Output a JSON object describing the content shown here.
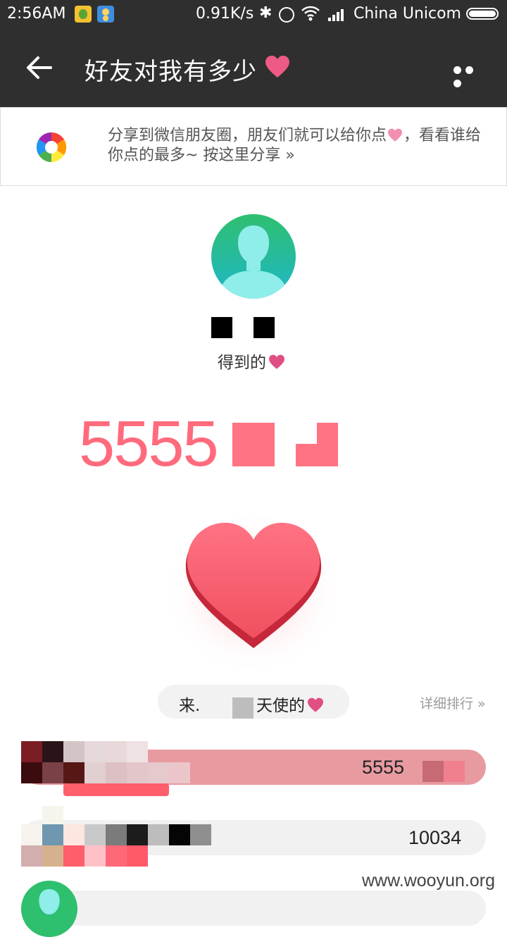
{
  "status_bar": {
    "time": "2:56AM",
    "speed": "0.91K/s",
    "carrier": "China Unicom"
  },
  "nav": {
    "title": "好友对我有多少",
    "accent": "#ee5a86"
  },
  "banner": {
    "text": "分享到微信朋友圈，朋友们就可以给你点",
    "text_after": "，看看谁给你点的最多~ 按这里分享 »"
  },
  "profile": {
    "received_label": "得到的"
  },
  "score": {
    "visible_digits": "5555"
  },
  "angels": {
    "prefix": "来.",
    "suffix": "天使的",
    "detail_link": "详细排行 »"
  },
  "ranking": [
    {
      "value": "5555",
      "fill": 1.0
    },
    {
      "value": "10034",
      "fill": 0.0
    },
    {
      "value": "",
      "fill": 0.0
    }
  ],
  "watermark": "www.wooyun.org",
  "colors": {
    "heart": "#ff5f73",
    "number": "#ff6b7d",
    "bar": "#e89aa1",
    "header": "#2f2f2f"
  }
}
